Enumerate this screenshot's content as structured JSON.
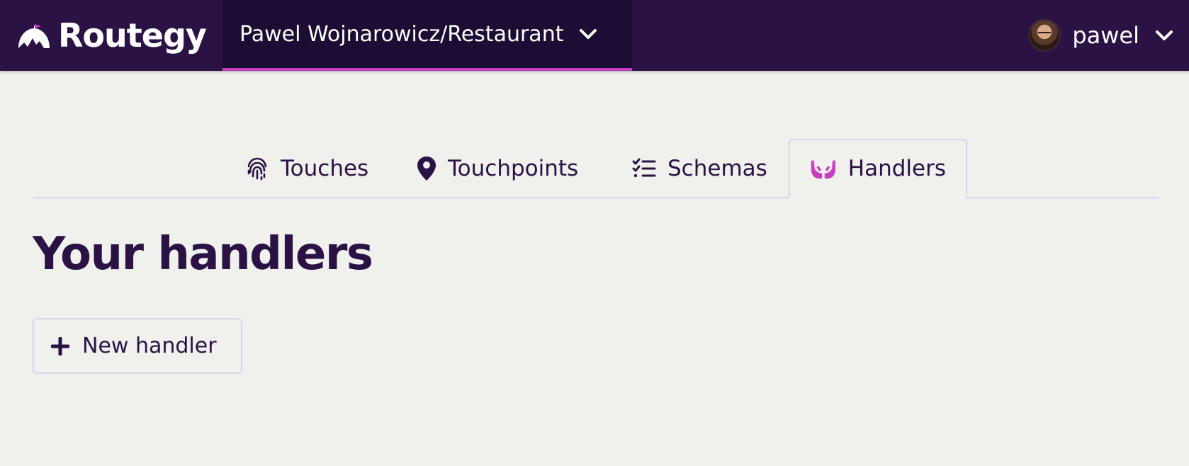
{
  "header": {
    "brand": {
      "name": "Routegy",
      "icon": "mountain-flag-logo"
    },
    "project": {
      "name": "Pawel Wojnarowicz/Restaurant",
      "icon": "chevron-down-icon"
    },
    "user": {
      "name": "pawel",
      "avatar": "user-avatar",
      "icon": "chevron-down-icon"
    },
    "colors": {
      "bar": "#2b1245",
      "project_bg": "#1d0c33",
      "accent": "#c73ec0"
    }
  },
  "tabs": [
    {
      "label": "Touches",
      "icon": "fingerprint-icon",
      "active": false
    },
    {
      "label": "Touchpoints",
      "icon": "map-pin-icon",
      "active": false
    },
    {
      "label": "Schemas",
      "icon": "checklist-icon",
      "active": false
    },
    {
      "label": "Handlers",
      "icon": "hands-icon",
      "active": true
    }
  ],
  "main": {
    "title": "Your handlers",
    "new_button": {
      "label": "New handler",
      "icon": "plus-icon"
    }
  }
}
